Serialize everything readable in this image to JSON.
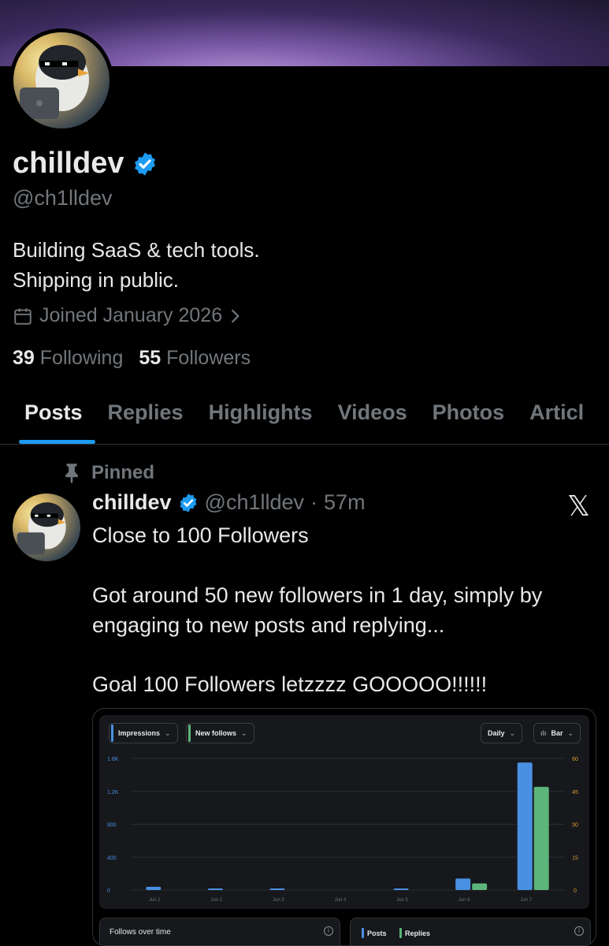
{
  "profile": {
    "display_name": "chilldev",
    "handle": "@ch1lldev",
    "bio_line1": "Building SaaS & tech tools.",
    "bio_line2": "Shipping in public.",
    "joined": "Joined January 2026",
    "following_count": "39",
    "following_label": "Following",
    "followers_count": "55",
    "followers_label": "Followers",
    "verified_color": "#1d9bf0"
  },
  "tabs": [
    {
      "label": "Posts",
      "active": true
    },
    {
      "label": "Replies"
    },
    {
      "label": "Highlights"
    },
    {
      "label": "Videos"
    },
    {
      "label": "Photos"
    },
    {
      "label": "Articl"
    }
  ],
  "pinned_post": {
    "pinned_label": "Pinned",
    "author": "chilldev",
    "handle": "@ch1lldev",
    "separator": "·",
    "time": "57m",
    "line1": "Close to 100 Followers",
    "line2": "Got around 50 new followers in 1 day, simply by engaging to new posts and replying...",
    "line3": "Goal 100 Followers letzzzz GOOOOO!!!!!!"
  },
  "analytics": {
    "metric1": "Impressions",
    "metric2": "New follows",
    "interval": "Daily",
    "chart_type_label": "Bar",
    "sub_card1_title": "Follows over time",
    "legend_posts": "Posts",
    "legend_replies": "Replies",
    "impressions_color": "#4a90e2",
    "follows_color": "#5cb57a"
  },
  "chart_data": {
    "type": "bar",
    "categories": [
      "Jun 1",
      "Jun 2",
      "Jun 3",
      "Jun 4",
      "Jun 5",
      "Jun 6",
      "Jun 7"
    ],
    "series": [
      {
        "name": "Impressions",
        "axis": "left",
        "values": [
          40,
          15,
          8,
          0,
          5,
          140,
          1550
        ]
      },
      {
        "name": "New follows",
        "axis": "right",
        "values": [
          0,
          0,
          0,
          0,
          0,
          3,
          47
        ]
      }
    ],
    "y_left_ticks": [
      "0",
      "400",
      "800",
      "1.2K",
      "1.6K"
    ],
    "y_left_lim": [
      0,
      1600
    ],
    "y_right_ticks": [
      "0",
      "15",
      "30",
      "45",
      "60"
    ],
    "y_right_lim": [
      0,
      60
    ],
    "grid": true
  }
}
